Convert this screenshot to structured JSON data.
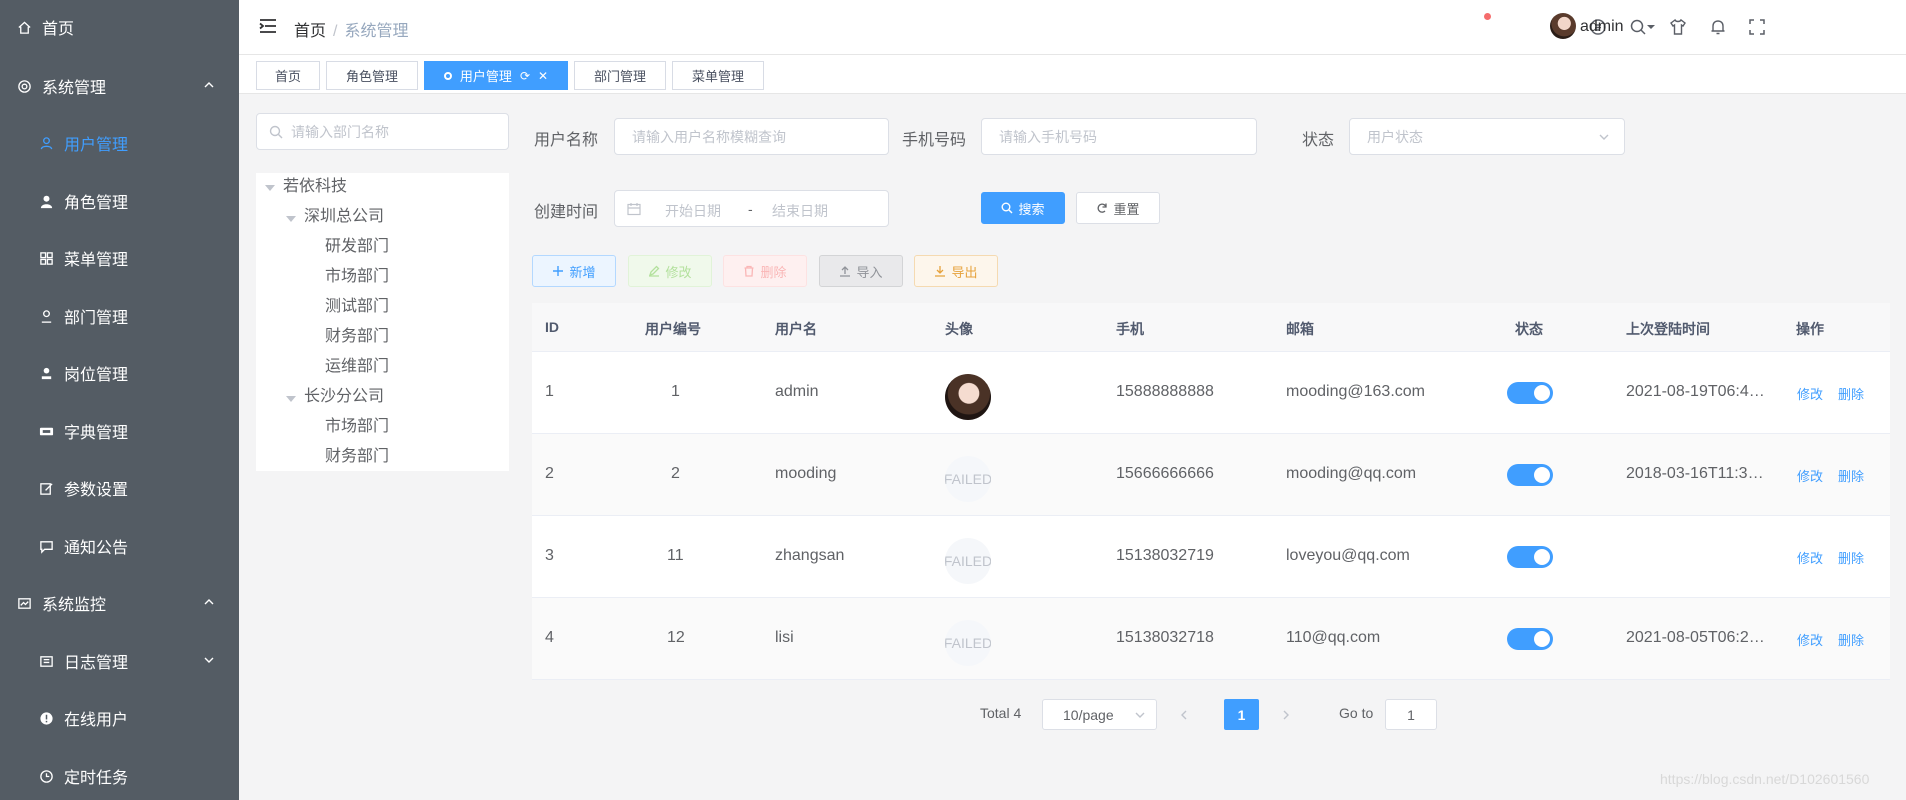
{
  "sidebar": {
    "items": [
      {
        "label": "首页",
        "icon": "home-icon"
      },
      {
        "label": "系统管理",
        "icon": "gear-icon"
      },
      {
        "label": "用户管理",
        "icon": "user-icon"
      },
      {
        "label": "角色管理",
        "icon": "role-icon"
      },
      {
        "label": "菜单管理",
        "icon": "grid-icon"
      },
      {
        "label": "部门管理",
        "icon": "dept-icon"
      },
      {
        "label": "岗位管理",
        "icon": "post-icon"
      },
      {
        "label": "字典管理",
        "icon": "dict-icon"
      },
      {
        "label": "参数设置",
        "icon": "edit-icon"
      },
      {
        "label": "通知公告",
        "icon": "message-icon"
      },
      {
        "label": "系统监控",
        "icon": "monitor-icon"
      },
      {
        "label": "日志管理",
        "icon": "log-icon"
      },
      {
        "label": "在线用户",
        "icon": "online-icon"
      },
      {
        "label": "定时任务",
        "icon": "clock-icon"
      }
    ]
  },
  "header": {
    "breadcrumb": [
      "首页",
      "系统管理"
    ],
    "username": "admin"
  },
  "tags": [
    "首页",
    "角色管理",
    "用户管理",
    "部门管理",
    "菜单管理"
  ],
  "dept": {
    "search_placeholder": "请输入部门名称",
    "tree": {
      "root": "若依科技",
      "branch1": "深圳总公司",
      "branch1_children": [
        "研发部门",
        "市场部门",
        "测试部门",
        "财务部门",
        "运维部门"
      ],
      "branch2": "长沙分公司",
      "branch2_children": [
        "市场部门",
        "财务部门"
      ]
    }
  },
  "filters": {
    "username_label": "用户名称",
    "username_placeholder": "请输入用户名称模糊查询",
    "phone_label": "手机号码",
    "phone_placeholder": "请输入手机号码",
    "status_label": "状态",
    "status_placeholder": "用户状态",
    "created_label": "创建时间",
    "start_placeholder": "开始日期",
    "range_sep": "-",
    "end_placeholder": "结束日期",
    "search_btn": "搜索",
    "reset_btn": "重置"
  },
  "toolbar": {
    "add": "新增",
    "edit": "修改",
    "delete": "删除",
    "import": "导入",
    "export": "导出"
  },
  "table": {
    "columns": [
      "ID",
      "用户编号",
      "用户名",
      "头像",
      "手机",
      "邮箱",
      "状态",
      "上次登陆时间",
      "操作"
    ],
    "rows": [
      {
        "id": "1",
        "no": "1",
        "name": "admin",
        "avatar": "image",
        "phone": "15888888888",
        "email": "mooding@163.com",
        "status": true,
        "last_login": "2021-08-19T06:4…"
      },
      {
        "id": "2",
        "no": "2",
        "name": "mooding",
        "avatar": "FAILED",
        "phone": "15666666666",
        "email": "mooding@qq.com",
        "status": true,
        "last_login": "2018-03-16T11:3…"
      },
      {
        "id": "3",
        "no": "11",
        "name": "zhangsan",
        "avatar": "FAILED",
        "phone": "15138032719",
        "email": "loveyou@qq.com",
        "status": true,
        "last_login": ""
      },
      {
        "id": "4",
        "no": "12",
        "name": "lisi",
        "avatar": "FAILED",
        "phone": "15138032718",
        "email": "110@qq.com",
        "status": true,
        "last_login": "2021-08-05T06:2…"
      }
    ],
    "edit_label": "修改",
    "delete_label": "删除"
  },
  "pagination": {
    "total": "Total 4",
    "page_size": "10/page",
    "current": "1",
    "goto_label": "Go to",
    "goto_value": "1"
  },
  "watermark": "https://blog.csdn.net/D102601560",
  "colors": {
    "primary": "#409eff",
    "sidebar_bg": "#545c64",
    "danger": "#f56c6c"
  }
}
